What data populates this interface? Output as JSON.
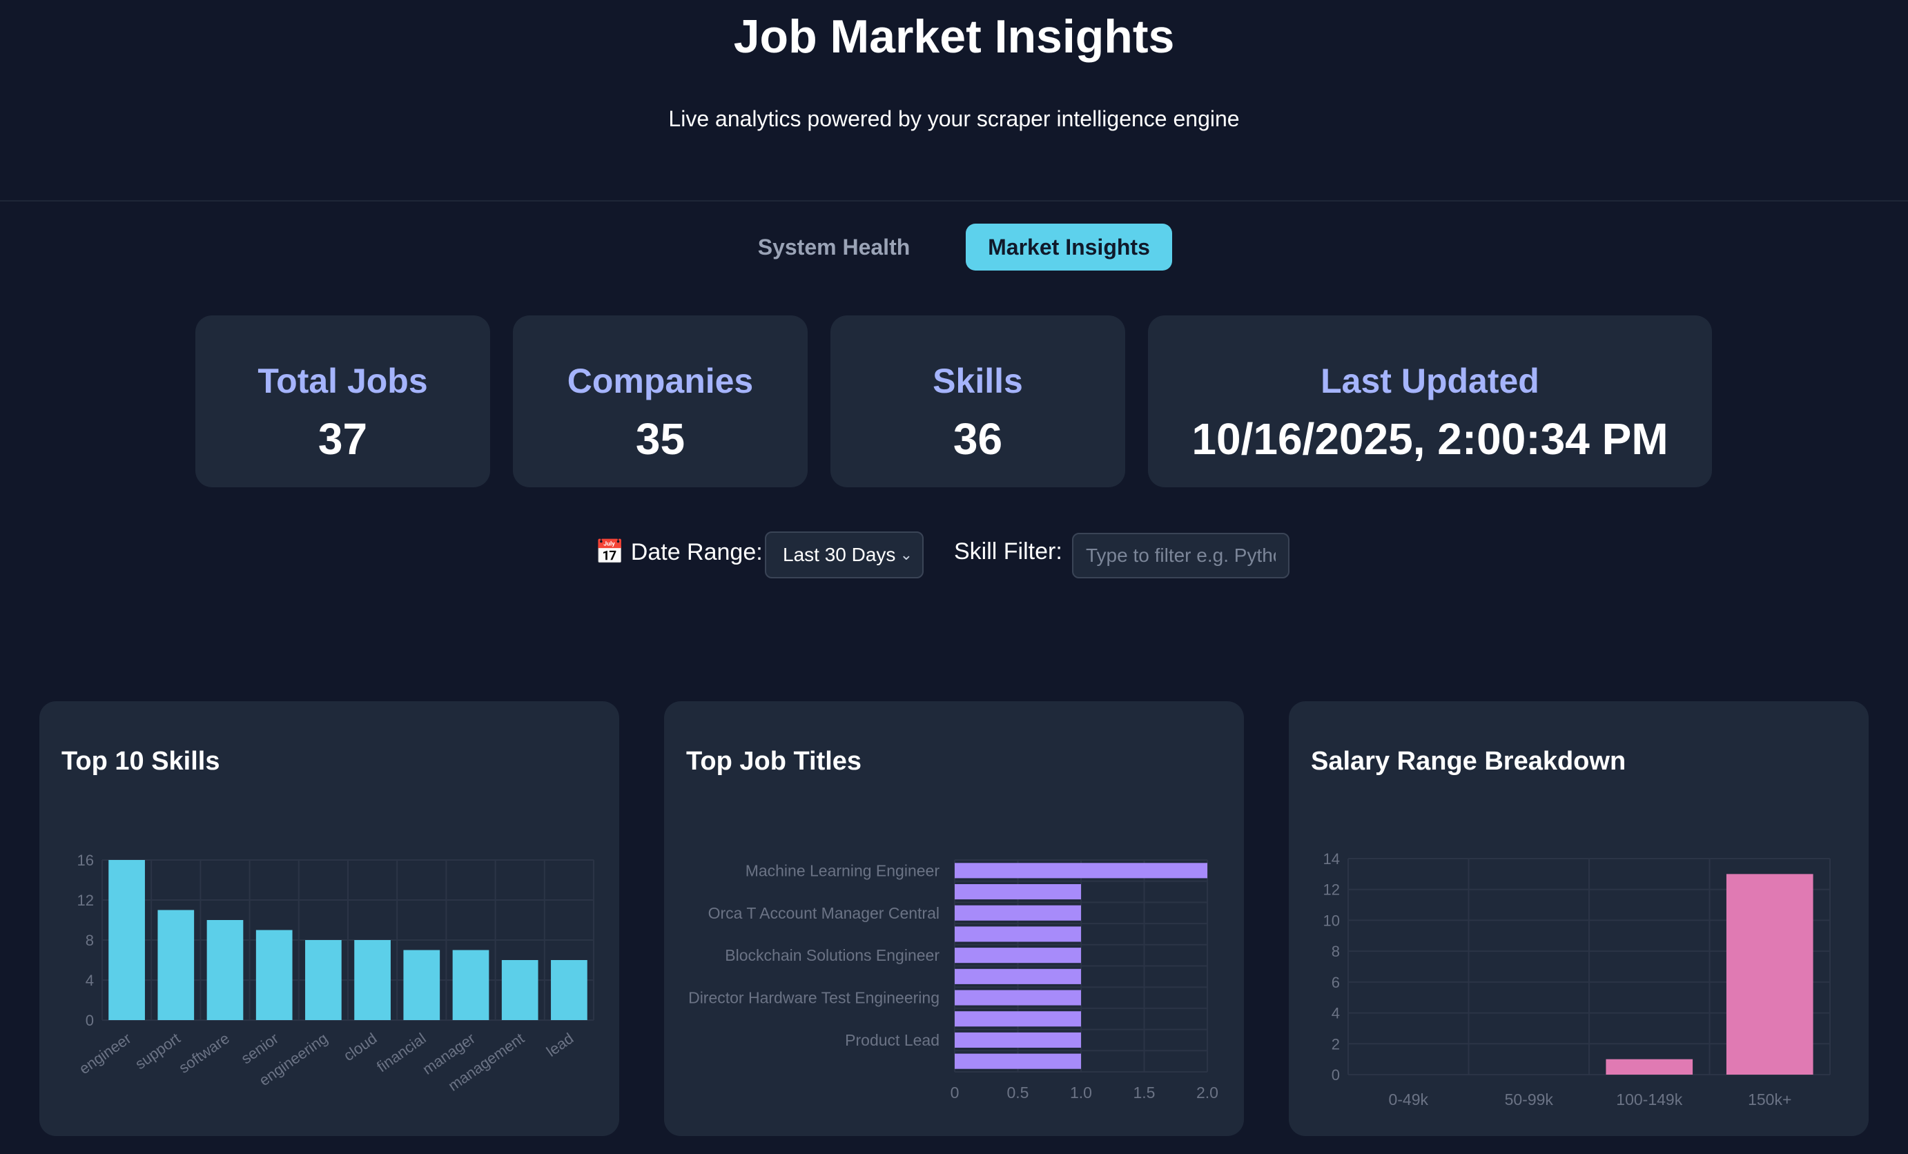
{
  "header": {
    "title": "Job Market Insights",
    "subtitle": "Live analytics powered by your scraper intelligence engine"
  },
  "tabs": [
    {
      "label": "System Health",
      "active": false
    },
    {
      "label": "Market Insights",
      "active": true
    }
  ],
  "stats": [
    {
      "label": "Total Jobs",
      "value": "37"
    },
    {
      "label": "Companies",
      "value": "35"
    },
    {
      "label": "Skills",
      "value": "36"
    },
    {
      "label": "Last Updated",
      "value": "10/16/2025, 2:00:34 PM"
    }
  ],
  "filters": {
    "date_icon": "calendar-icon",
    "date_label": "📅 Date Range:",
    "date_value": "Last 30 Days",
    "skill_label": "Skill Filter:",
    "skill_placeholder": "Type to filter e.g. Python"
  },
  "colors": {
    "accent": "#5dd1ec",
    "label": "#a5b4fc",
    "skills_bar": "#5ccfe9",
    "titles_bar": "#a78bfa",
    "salary_bar": "#e07ab3"
  },
  "chart_data": [
    {
      "type": "bar",
      "title": "Top 10 Skills",
      "categories": [
        "engineer",
        "support",
        "software",
        "senior",
        "engineering",
        "cloud",
        "financial",
        "manager",
        "management",
        "lead"
      ],
      "values": [
        16,
        11,
        10,
        9,
        8,
        8,
        7,
        7,
        6,
        6
      ],
      "ylim": [
        0,
        16
      ],
      "yticks": [
        0,
        4,
        8,
        12,
        16
      ],
      "grid": true
    },
    {
      "type": "bar",
      "orientation": "horizontal",
      "title": "Top Job Titles",
      "categories": [
        "Machine Learning Engineer",
        "",
        "Orca T Account Manager Central",
        "",
        "Blockchain Solutions Engineer",
        "",
        "Director Hardware Test Engineering",
        "",
        "Product Lead",
        ""
      ],
      "values": [
        2,
        1,
        1,
        1,
        1,
        1,
        1,
        1,
        1,
        1
      ],
      "xlim": [
        0,
        2
      ],
      "xticks": [
        "0",
        "0.5",
        "1.0",
        "1.5",
        "2.0"
      ],
      "grid": true
    },
    {
      "type": "bar",
      "title": "Salary Range Breakdown",
      "categories": [
        "0-49k",
        "50-99k",
        "100-149k",
        "150k+"
      ],
      "values": [
        0,
        0,
        1,
        13
      ],
      "ylim": [
        0,
        14
      ],
      "yticks": [
        0,
        2,
        4,
        6,
        8,
        10,
        12,
        14
      ],
      "grid": true
    }
  ]
}
